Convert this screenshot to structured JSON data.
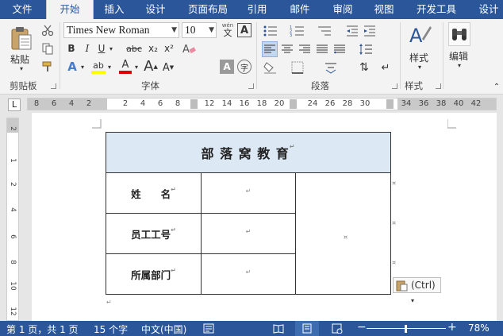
{
  "tabs": [
    {
      "label": "文件",
      "active": false
    },
    {
      "label": "开始",
      "active": true
    },
    {
      "label": "插入",
      "active": false
    },
    {
      "label": "设计",
      "active": false
    },
    {
      "label": "页面布局",
      "active": false
    },
    {
      "label": "引用",
      "active": false
    },
    {
      "label": "邮件",
      "active": false
    },
    {
      "label": "审阅",
      "active": false
    },
    {
      "label": "视图",
      "active": false
    },
    {
      "label": "开发工具",
      "active": false
    },
    {
      "label": "设计",
      "active": false
    }
  ],
  "clipboard": {
    "paste_label": "粘贴",
    "group_label": "剪贴板"
  },
  "font": {
    "name": "Times New Roman",
    "size": "10",
    "wen_icon_text": "wén",
    "wen_char": "文",
    "boxed_a": "A",
    "bold": "B",
    "italic": "I",
    "underline": "U",
    "strike": "abc",
    "subscript": "x₂",
    "superscript": "x²",
    "text_effects": "A",
    "highlight": "ab",
    "font_color": "A",
    "char_shading": "A",
    "enclose_char": "字",
    "grow": "A",
    "shrink": "A",
    "group_label": "字体"
  },
  "paragraph": {
    "group_label": "段落"
  },
  "styles": {
    "label": "样式",
    "group_label": "样式"
  },
  "editing": {
    "label": "编辑"
  },
  "ruler": {
    "h_ticks": [
      "8",
      "6",
      "4",
      "2",
      "2",
      "4",
      "6",
      "8",
      "12",
      "14",
      "16",
      "18",
      "20",
      "24",
      "26",
      "28",
      "30",
      "34",
      "36",
      "38",
      "40",
      "42"
    ],
    "v_ticks": [
      "2",
      "1",
      "2",
      "4",
      "6",
      "8",
      "10",
      "12"
    ],
    "tab_marker": "L"
  },
  "document": {
    "title": "部 落 窝 教 育",
    "rows": [
      {
        "label": "姓　　名"
      },
      {
        "label": "员工工号"
      },
      {
        "label": "所属部门"
      }
    ],
    "para_mark": "↵"
  },
  "paste_options": {
    "label": "(Ctrl)"
  },
  "status": {
    "page": "第 1 页，共 1 页",
    "words": "15 个字",
    "language": "中文(中国)",
    "zoom": "78%",
    "zoom_minus": "−",
    "zoom_plus": "+"
  },
  "colors": {
    "brand": "#2b579a",
    "title_cell_bg": "#dde8f5",
    "highlight": "#ffff00",
    "font_color": "#e00000"
  }
}
